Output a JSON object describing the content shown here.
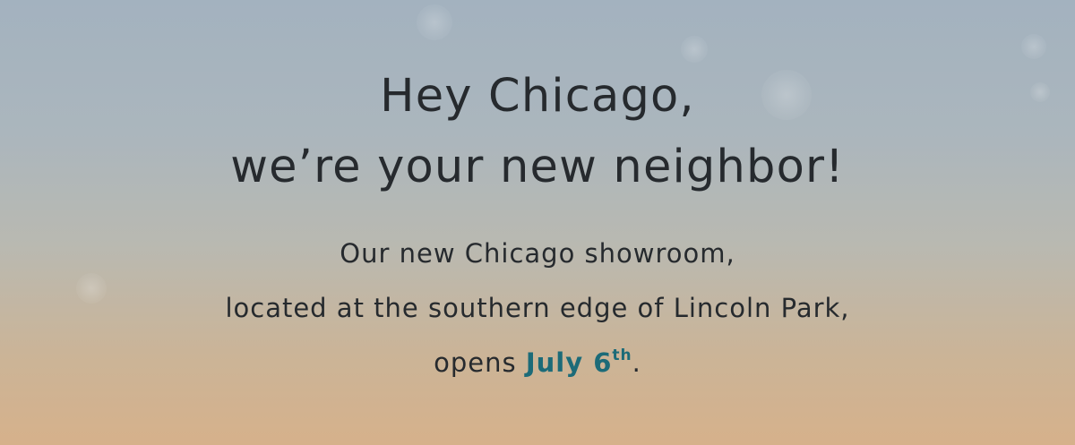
{
  "headline": {
    "line1": "Hey Chicago,",
    "line2": "we’re your new neighbor!"
  },
  "body": {
    "line1": "Our new Chicago showroom,",
    "line2": "located at the southern edge of Lincoln Park,",
    "line3_prefix": "opens ",
    "date_main": "July 6",
    "date_suffix": "th",
    "line3_end": "."
  },
  "colors": {
    "text": "#262a2e",
    "accent": "#1c6b78",
    "background_top": "#a3b2bf",
    "background_bottom": "#d6b18b"
  }
}
